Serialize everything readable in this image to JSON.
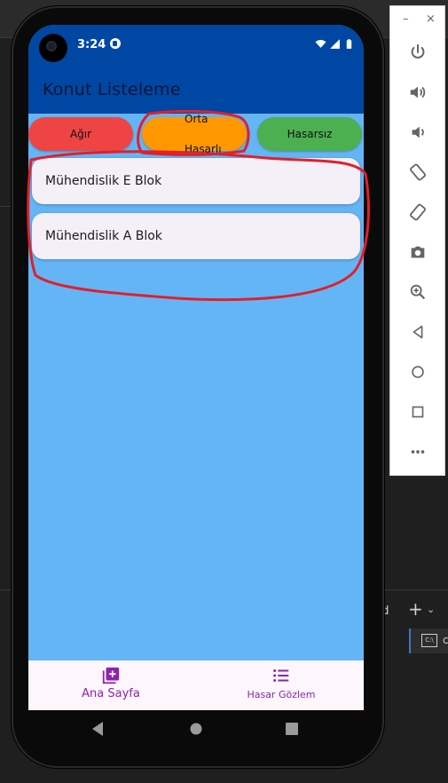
{
  "app": {
    "title": "Konut Listeleme",
    "status_time": "3:24",
    "accent_color": "#0047a3",
    "background_color": "#64b5f6"
  },
  "filters": {
    "agir": "Ağır",
    "orta_line1": "Orta",
    "orta_line2": "Hasarlı",
    "hasarsiz": "Hasarsız",
    "colors": {
      "agir": "#ef4444",
      "orta": "#ff9800",
      "hasarsiz": "#4caf50"
    }
  },
  "list": {
    "items": [
      {
        "label": "Mühendislik E Blok"
      },
      {
        "label": "Mühendislik A Blok"
      }
    ]
  },
  "bottom_nav": {
    "home": "Ana Sayfa",
    "hasar": "Hasar Gözlem",
    "active_color": "#8e24aa"
  },
  "emulator_toolbar": {
    "icons": [
      "minimize-icon",
      "close-icon",
      "power-icon",
      "volume-up-icon",
      "volume-down-icon",
      "rotate-left-icon",
      "rotate-right-icon",
      "camera-icon",
      "zoom-icon",
      "back-icon",
      "home-icon",
      "overview-icon",
      "more-icon"
    ]
  },
  "ide": {
    "terminal_label": "nd",
    "terminal_tab": "c"
  }
}
